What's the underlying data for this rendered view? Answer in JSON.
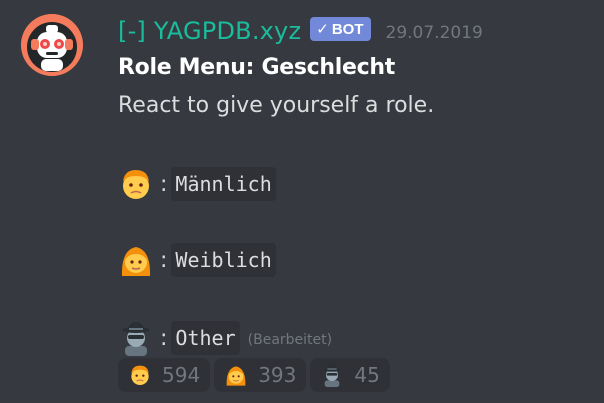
{
  "message": {
    "author": {
      "username": "[-] YAGPDB.xyz",
      "bot_tag": "BOT",
      "bot_check": "✓",
      "avatar_icon": "robot-avatar-icon"
    },
    "timestamp": "29.07.2019",
    "title": "Role Menu: Geschlecht",
    "description": "React to give yourself a role.",
    "options": [
      {
        "emoji": "man-emoji",
        "separator": ":",
        "role": "Männlich"
      },
      {
        "emoji": "woman-emoji",
        "separator": ":",
        "role": "Weiblich"
      },
      {
        "emoji": "detective-emoji",
        "separator": ":",
        "role": "Other"
      }
    ],
    "edited_label": "(Bearbeitet)"
  },
  "reactions": [
    {
      "emoji": "man-emoji",
      "count": "594"
    },
    {
      "emoji": "woman-emoji",
      "count": "393"
    },
    {
      "emoji": "detective-emoji",
      "count": "45"
    }
  ],
  "colors": {
    "background": "#36393f",
    "username": "#1abc9c",
    "bot_tag": "#7289da",
    "avatar_bg": "#f47b5b",
    "code_bg": "#2f3136",
    "muted": "#72767d"
  }
}
